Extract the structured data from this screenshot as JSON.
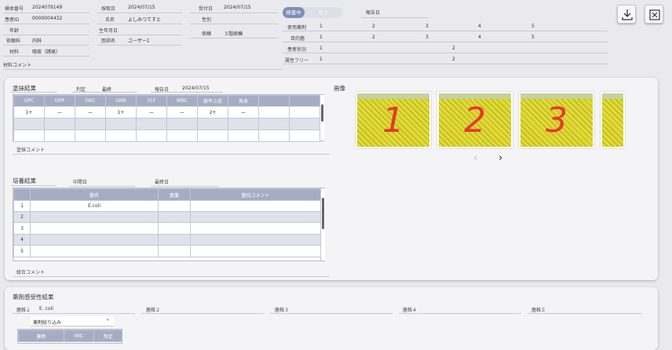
{
  "header": {
    "specimen_no_label": "検体番号",
    "specimen_no": "2024079149",
    "patient_id_label": "患者ID",
    "patient_id": "0000004432",
    "age_label": "年齢",
    "dept_label": "依頼科",
    "dept": "内科",
    "material_label": "材料",
    "material": "喀痰（誘発）",
    "collection_label": "採取日",
    "collection_date": "2024/07/15",
    "name_label": "氏名",
    "name": "よしみつてすと",
    "birth_label": "生年月日",
    "doctor_label": "医師名",
    "doctor": "ユーザー1",
    "received_label": "受付日",
    "received_date": "2024/07/15",
    "sex_label": "性別",
    "ward_label": "病棟",
    "ward": "３階病棟",
    "material_comment_label": "材料コメント"
  },
  "status": {
    "toggle_active": "検査中",
    "toggle_inactive": "報告",
    "report_date_label": "報告日"
  },
  "summary": {
    "drugs_label": "使用薬剤",
    "purpose_label": "目的菌",
    "patient_status_label": "患者状況",
    "attr_label": "属性フリー",
    "drugs": [
      "1",
      "2",
      "3",
      "4",
      "5"
    ],
    "purpose": [
      "1",
      "2",
      "3",
      "4",
      "5"
    ],
    "patient_status": [
      "1",
      "2"
    ],
    "attr": [
      "1",
      "2"
    ]
  },
  "smear": {
    "title": "塗抹結果",
    "judgment_label": "判定",
    "judgment_value": "最終",
    "report_date_label": "報告日",
    "report_date": "2024/07/15",
    "columns": [
      "GPC",
      "GPR",
      "GNC",
      "GNR",
      "YLF",
      "WBC",
      "扁平上皮",
      "貪食"
    ],
    "row1": [
      "1+",
      "ー",
      "ー",
      "1+",
      "ー",
      "ー",
      "2+",
      "ー"
    ],
    "comment_label": "塗抹コメント"
  },
  "images": {
    "title": "画像",
    "labels": [
      "1",
      "2",
      "3"
    ],
    "prev": "‹",
    "next": "›"
  },
  "culture": {
    "title": "培養結果",
    "interim_label": "中間日",
    "final_label": "最終日",
    "col_name": "菌名",
    "col_count": "菌量",
    "col_comment": "菌別コメント",
    "rows": [
      {
        "no": "1",
        "name": "E.coli"
      },
      {
        "no": "2",
        "name": ""
      },
      {
        "no": "3",
        "name": ""
      },
      {
        "no": "4",
        "name": ""
      },
      {
        "no": "5",
        "name": ""
      }
    ],
    "overall_comment_label": "総合コメント"
  },
  "sensitivity": {
    "title": "薬剤感受性結果",
    "strain1_label": "菌株１",
    "strain1_value": "E. coli",
    "strain2_label": "菌株２",
    "strain3_label": "菌株３",
    "strain4_label": "菌株４",
    "strain5_label": "菌株５",
    "filter_label": "薬剤絞り込み",
    "col_drug": "薬剤",
    "col_mic": "MIC",
    "col_judge": "判定"
  },
  "icons": {
    "download": "download-icon",
    "close": "close-icon"
  }
}
